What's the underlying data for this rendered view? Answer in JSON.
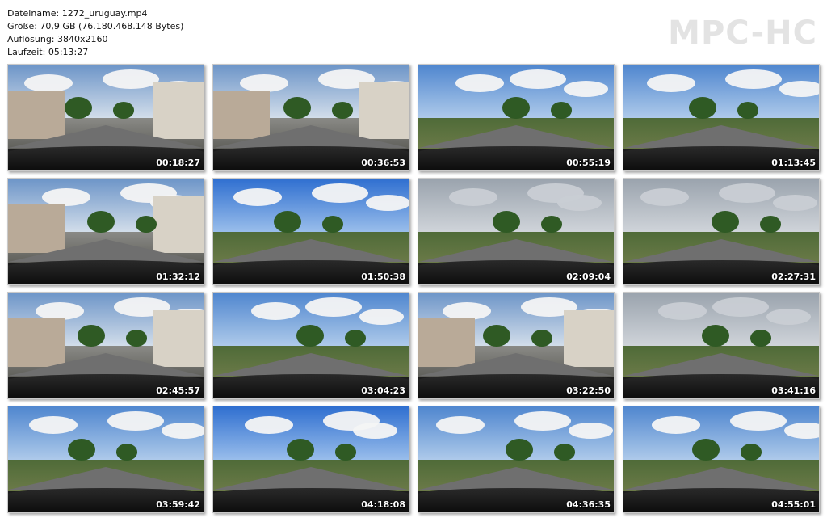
{
  "file_info": {
    "filename": "Dateiname: 1272_uruguay.mp4",
    "size": "Größe: 70,9 GB (76.180.468.148 Bytes)",
    "resolution": "Auflösung: 3840x2160",
    "duration": "Laufzeit: 05:13:27"
  },
  "brand": "MPC-HC",
  "thumbnails": [
    {
      "time": "00:18:27",
      "scene": "city"
    },
    {
      "time": "00:36:53",
      "scene": "city"
    },
    {
      "time": "00:55:19",
      "scene": "open"
    },
    {
      "time": "01:13:45",
      "scene": "open"
    },
    {
      "time": "01:32:12",
      "scene": "city"
    },
    {
      "time": "01:50:38",
      "scene": "sun"
    },
    {
      "time": "02:09:04",
      "scene": "cloudy"
    },
    {
      "time": "02:27:31",
      "scene": "cloudy"
    },
    {
      "time": "02:45:57",
      "scene": "city"
    },
    {
      "time": "03:04:23",
      "scene": "open"
    },
    {
      "time": "03:22:50",
      "scene": "city"
    },
    {
      "time": "03:41:16",
      "scene": "cloudy"
    },
    {
      "time": "03:59:42",
      "scene": "open"
    },
    {
      "time": "04:18:08",
      "scene": "sun"
    },
    {
      "time": "04:36:35",
      "scene": "open"
    },
    {
      "time": "04:55:01",
      "scene": "open"
    }
  ]
}
